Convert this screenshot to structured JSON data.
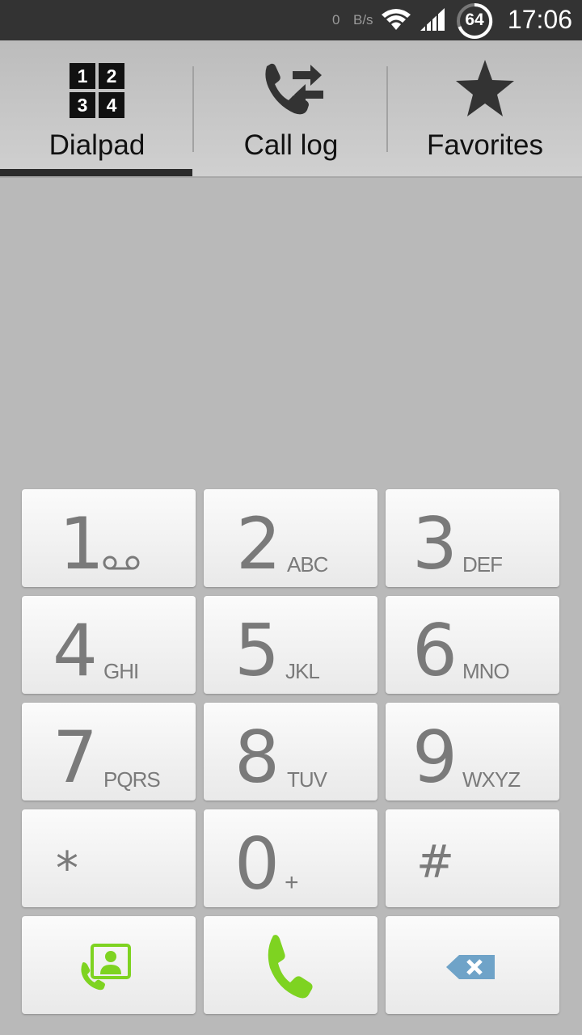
{
  "status_bar": {
    "net_speed_value": "0",
    "net_speed_unit": "B/s",
    "battery_level": "64",
    "time": "17:06"
  },
  "tabs": [
    {
      "label": "Dialpad",
      "icon": "dialpad-grid-icon",
      "selected": true,
      "icon_digits": [
        "1",
        "2",
        "3",
        "4"
      ]
    },
    {
      "label": "Call log",
      "icon": "call-log-icon",
      "selected": false
    },
    {
      "label": "Favorites",
      "icon": "star-icon",
      "selected": false
    }
  ],
  "keypad": {
    "keys": [
      {
        "digit": "1",
        "letters": "",
        "icon": "voicemail-icon"
      },
      {
        "digit": "2",
        "letters": "ABC"
      },
      {
        "digit": "3",
        "letters": "DEF"
      },
      {
        "digit": "4",
        "letters": "GHI"
      },
      {
        "digit": "5",
        "letters": "JKL"
      },
      {
        "digit": "6",
        "letters": "MNO"
      },
      {
        "digit": "7",
        "letters": "PQRS"
      },
      {
        "digit": "8",
        "letters": "TUV"
      },
      {
        "digit": "9",
        "letters": "WXYZ"
      },
      {
        "digit": "*",
        "letters": ""
      },
      {
        "digit": "0",
        "letters": "+"
      },
      {
        "digit": "#",
        "letters": ""
      }
    ],
    "actions": [
      {
        "icon": "contacts-icon"
      },
      {
        "icon": "call-icon"
      },
      {
        "icon": "backspace-icon"
      }
    ]
  },
  "colors": {
    "status_bar_bg": "#333333",
    "background": "#b9b9b9",
    "key_text": "#7a7a7a",
    "call_green": "#7ed321",
    "backspace_blue": "#6fa3c8"
  }
}
